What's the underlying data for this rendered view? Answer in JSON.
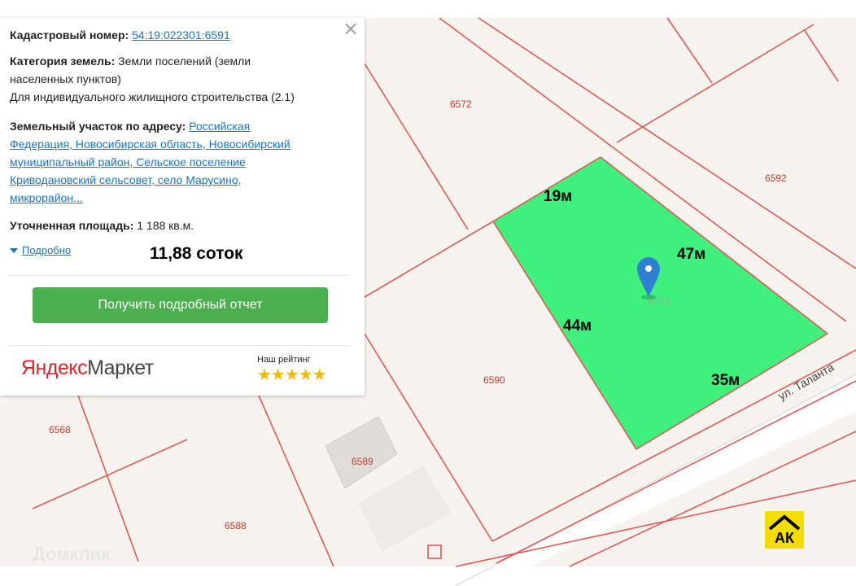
{
  "panel": {
    "cadastral_label": "Кадастровый номер:",
    "cadastral_value": "54:19:022301:6591",
    "category_label": "Категория земель:",
    "category_value_1": "Земли поселений (земли",
    "category_value_2": "населенных пунктов)",
    "category_value_3": "Для индивидуального жилищного строительства (2.1)",
    "address_label": "Земельный участок по адресу:",
    "address_1": "Российская",
    "address_2": "Федерация, Новосибирская область, Новосибирский",
    "address_3": "муниципальный район, Сельское поселение",
    "address_4": "Криводановский сельсовет, село Марусино,",
    "address_5": "микрорайон...",
    "area_label": "Уточненная площадь:",
    "area_value": "1 188 кв.м.",
    "details_link": "Подробно",
    "sotok": "11,88 соток",
    "report_button": "Получить подробный отчет",
    "close_symbol": "×",
    "logo_ya": "Яндекс",
    "logo_market": "Маркет",
    "rating_label": "Наш рейтинг",
    "rating_value": 5,
    "rating_stars": "★★★★★"
  },
  "map": {
    "parcels": [
      "6572",
      "6592",
      "6591",
      "6590",
      "6568",
      "6589",
      "6588"
    ],
    "dimensions": {
      "top": "19м",
      "right": "47м",
      "left": "44м",
      "bottom": "35м"
    },
    "street": "ул. Таланта",
    "highlight_color": "#3ff07c",
    "boundary_color": "#e05a55",
    "marker_color": "#2f7fd3"
  },
  "watermark": "Домклик",
  "badge": "АК"
}
